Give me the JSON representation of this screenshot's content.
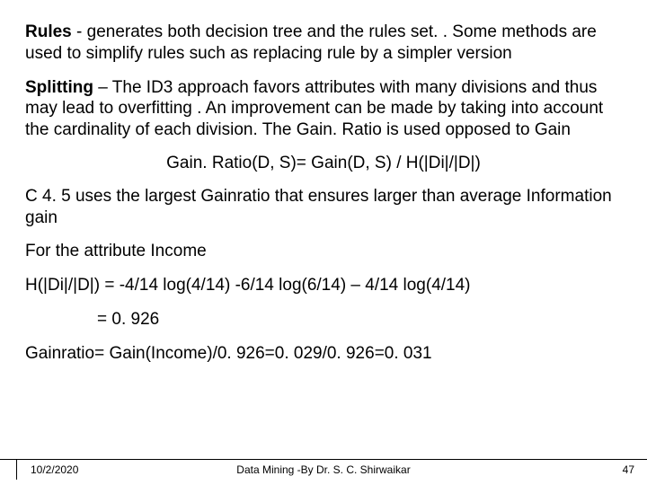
{
  "p1_prefix": "Rules",
  "p1_rest": " - generates both decision tree and the rules set. . Some methods are used to simplify rules such as replacing rule by a simpler version",
  "p2_prefix": "Splitting",
  "p2_rest": " – The ID3 approach favors attributes with many divisions and thus may lead to overfitting . An improvement can be made by taking into account the cardinality of each division. The Gain. Ratio is used opposed to Gain",
  "formula1": "Gain. Ratio(D, S)= Gain(D, S) / H(|Di|/|D|)",
  "p3": "C 4. 5 uses the largest Gainratio that ensures larger than average Information gain",
  "p4": "For the attribute Income",
  "p5": "H(|Di|/|D|) = -4/14 log(4/14) -6/14 log(6/14) – 4/14 log(4/14)",
  "p6": "= 0. 926",
  "p7": "Gainratio= Gain(Income)/0. 926=0. 029/0. 926=0. 031",
  "footer": {
    "date": "10/2/2020",
    "title": "Data Mining -By Dr. S. C. Shirwaikar",
    "page": "47"
  }
}
